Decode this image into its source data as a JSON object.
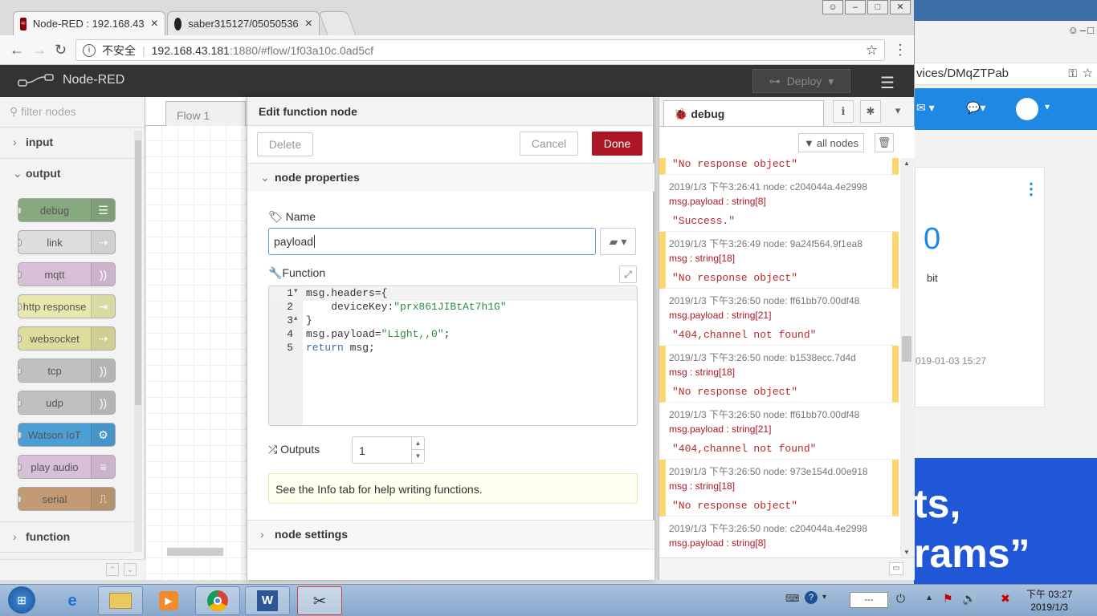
{
  "browser": {
    "tabs": [
      {
        "title": "Node-RED : 192.168.43",
        "close": "×"
      },
      {
        "title": "saber315127/05050536",
        "close": "×"
      }
    ],
    "security_label": "不安全",
    "url_host": "192.168.43.181",
    "url_rest": ":1880/#flow/1f03a10c.0ad5cf"
  },
  "background_window": {
    "address_fragment": "vices/DMqZTPab",
    "card_value": "0",
    "card_unit": "bit",
    "card_timestamp": "019-01-03 15:27",
    "promo_line1": "ts,",
    "promo_line2": "rams”"
  },
  "header": {
    "app_title": "Node-RED",
    "deploy_label": "Deploy"
  },
  "palette": {
    "filter_placeholder": "filter nodes",
    "categories": {
      "input": "input",
      "output": "output",
      "function": "function"
    },
    "nodes": [
      {
        "label": "debug",
        "color": "#87a980"
      },
      {
        "label": "link",
        "color": "#dddddd"
      },
      {
        "label": "mqtt",
        "color": "#d8bfd8"
      },
      {
        "label": "http response",
        "color": "#e7e7ae"
      },
      {
        "label": "websocket",
        "color": "#dcdc9d"
      },
      {
        "label": "tcp",
        "color": "#c0c0c0"
      },
      {
        "label": "udp",
        "color": "#c0c0c0"
      },
      {
        "label": "Watson IoT",
        "color": "#4b9fd5"
      },
      {
        "label": "play audio",
        "color": "#d8bfd8"
      },
      {
        "label": "serial",
        "color": "#c29b74"
      }
    ]
  },
  "workspace": {
    "flow_tab": "Flow 1"
  },
  "editor": {
    "title": "Edit function node",
    "delete_label": "Delete",
    "cancel_label": "Cancel",
    "done_label": "Done",
    "section_properties": "node properties",
    "name_label": "Name",
    "name_value": "payload",
    "function_label": "Function",
    "code_lines": [
      {
        "n": "1",
        "fold": "▾"
      },
      {
        "n": "2",
        "fold": ""
      },
      {
        "n": "3",
        "fold": "▴"
      },
      {
        "n": "4",
        "fold": ""
      },
      {
        "n": "5",
        "fold": ""
      }
    ],
    "code": {
      "l1a": "msg.headers={",
      "l2a": "    deviceKey:",
      "l2b": "\"prx861JIBtAt7h1G\"",
      "l3a": "}",
      "l4a": "msg.payload=",
      "l4b": "\"Light,,0\"",
      "l4c": ";",
      "l5a": "return",
      "l5b": " msg;"
    },
    "outputs_label": "Outputs",
    "outputs_value": "1",
    "tip": "See the Info tab for help writing functions.",
    "section_settings": "node settings"
  },
  "debug": {
    "tab_label": "debug",
    "filter_label": "all nodes",
    "messages": [
      {
        "meta": "",
        "topic": "",
        "value": "\"No response object\"",
        "warn": true
      },
      {
        "meta": "2019/1/3 下午3:26:41   node: c204044a.4e2998",
        "topic": "msg.payload : string[8]",
        "value": "\"Success.\"",
        "warn": false
      },
      {
        "meta": "2019/1/3 下午3:26:49   node: 9a24f564.9f1ea8",
        "topic": "msg : string[18]",
        "value": "\"No response object\"",
        "warn": true
      },
      {
        "meta": "2019/1/3 下午3:26:50   node: ff61bb70.00df48",
        "topic": "msg.payload : string[21]",
        "value": "\"404,channel not found\"",
        "warn": false
      },
      {
        "meta": "2019/1/3 下午3:26:50   node: b1538ecc.7d4d",
        "topic": "msg : string[18]",
        "value": "\"No response object\"",
        "warn": true
      },
      {
        "meta": "2019/1/3 下午3:26:50   node: ff61bb70.00df48",
        "topic": "msg.payload : string[21]",
        "value": "\"404,channel not found\"",
        "warn": false
      },
      {
        "meta": "2019/1/3 下午3:26:50   node: 973e154d.00e918",
        "topic": "msg : string[18]",
        "value": "\"No response object\"",
        "warn": true
      },
      {
        "meta": "2019/1/3 下午3:26:50   node: c204044a.4e2998",
        "topic": "msg.payload : string[8]",
        "value": "",
        "warn": false
      }
    ]
  },
  "taskbar": {
    "time": "下午 03:27",
    "date": "2019/1/3",
    "tray_text": "---"
  }
}
